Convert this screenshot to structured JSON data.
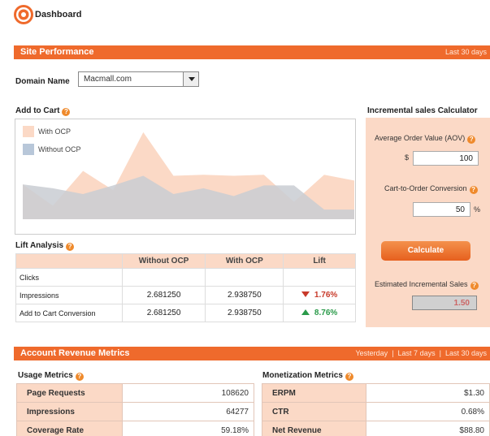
{
  "header": {
    "title": "Dashboard",
    "logo_icon": "ocp-logo-icon"
  },
  "site_performance": {
    "title": "Site Performance",
    "range": "Last 30 days"
  },
  "domain": {
    "label": "Domain Name",
    "value": "Macmall.com"
  },
  "add_to_cart": {
    "title": "Add to Cart",
    "legend": [
      {
        "label": "With OCP",
        "color": "#fbd9c6"
      },
      {
        "label": "Without OCP",
        "color": "#b8c7d9"
      }
    ]
  },
  "chart_data": {
    "type": "area",
    "title": "",
    "xlabel": "",
    "ylabel": "",
    "ylim": [
      0,
      100
    ],
    "grid": false,
    "legend_position": "top-left",
    "x": [
      0,
      1,
      2,
      3,
      4,
      5,
      6,
      7,
      8,
      9,
      10,
      11
    ],
    "series": [
      {
        "name": "With OCP",
        "color": "#fbd9c6",
        "values": [
          36,
          14,
          50,
          30,
          90,
          45,
          46,
          45,
          46,
          18,
          46,
          40
        ]
      },
      {
        "name": "Without OCP",
        "color": "#c9cdd2",
        "values": [
          36,
          32,
          26,
          35,
          45,
          26,
          32,
          24,
          35,
          35,
          10,
          10
        ]
      }
    ]
  },
  "lift_analysis": {
    "title": "Lift Analysis",
    "columns": [
      "",
      "Without OCP",
      "With OCP",
      "Lift"
    ],
    "rows": [
      {
        "label": "Clicks",
        "without": "",
        "with": "",
        "lift": "",
        "dir": ""
      },
      {
        "label": "Impressions",
        "without": "2.681250",
        "with": "2.938750",
        "lift": "1.76%",
        "dir": "down"
      },
      {
        "label": "Add to Cart Conversion",
        "without": "2.681250",
        "with": "2.938750",
        "lift": "8.76%",
        "dir": "up"
      }
    ]
  },
  "calculator": {
    "title": "Incremental sales Calculator",
    "aov_label": "Average Order Value (AOV)",
    "aov_unit": "$",
    "aov_value": "100",
    "conv_label": "Cart-to-Order Conversion",
    "conv_value": "50",
    "conv_unit": "%",
    "button": "Calculate",
    "result_label": "Estimated Incremental Sales",
    "result_value": "1.50"
  },
  "account_revenue": {
    "title": "Account Revenue Metrics",
    "ranges": [
      "Yesterday",
      "Last 7 days",
      "Last 30 days"
    ],
    "separator": "|"
  },
  "usage_metrics": {
    "title": "Usage Metrics",
    "rows": [
      {
        "label": "Page Requests",
        "value": "108620"
      },
      {
        "label": "Impressions",
        "value": "64277"
      },
      {
        "label": "Coverage Rate",
        "value": "59.18%"
      }
    ]
  },
  "monetization_metrics": {
    "title": "Monetization Metrics",
    "rows": [
      {
        "label": "ERPM",
        "value": "$1.30"
      },
      {
        "label": "CTR",
        "value": "0.68%"
      },
      {
        "label": "Net Revenue",
        "value": "$88.80"
      }
    ]
  }
}
